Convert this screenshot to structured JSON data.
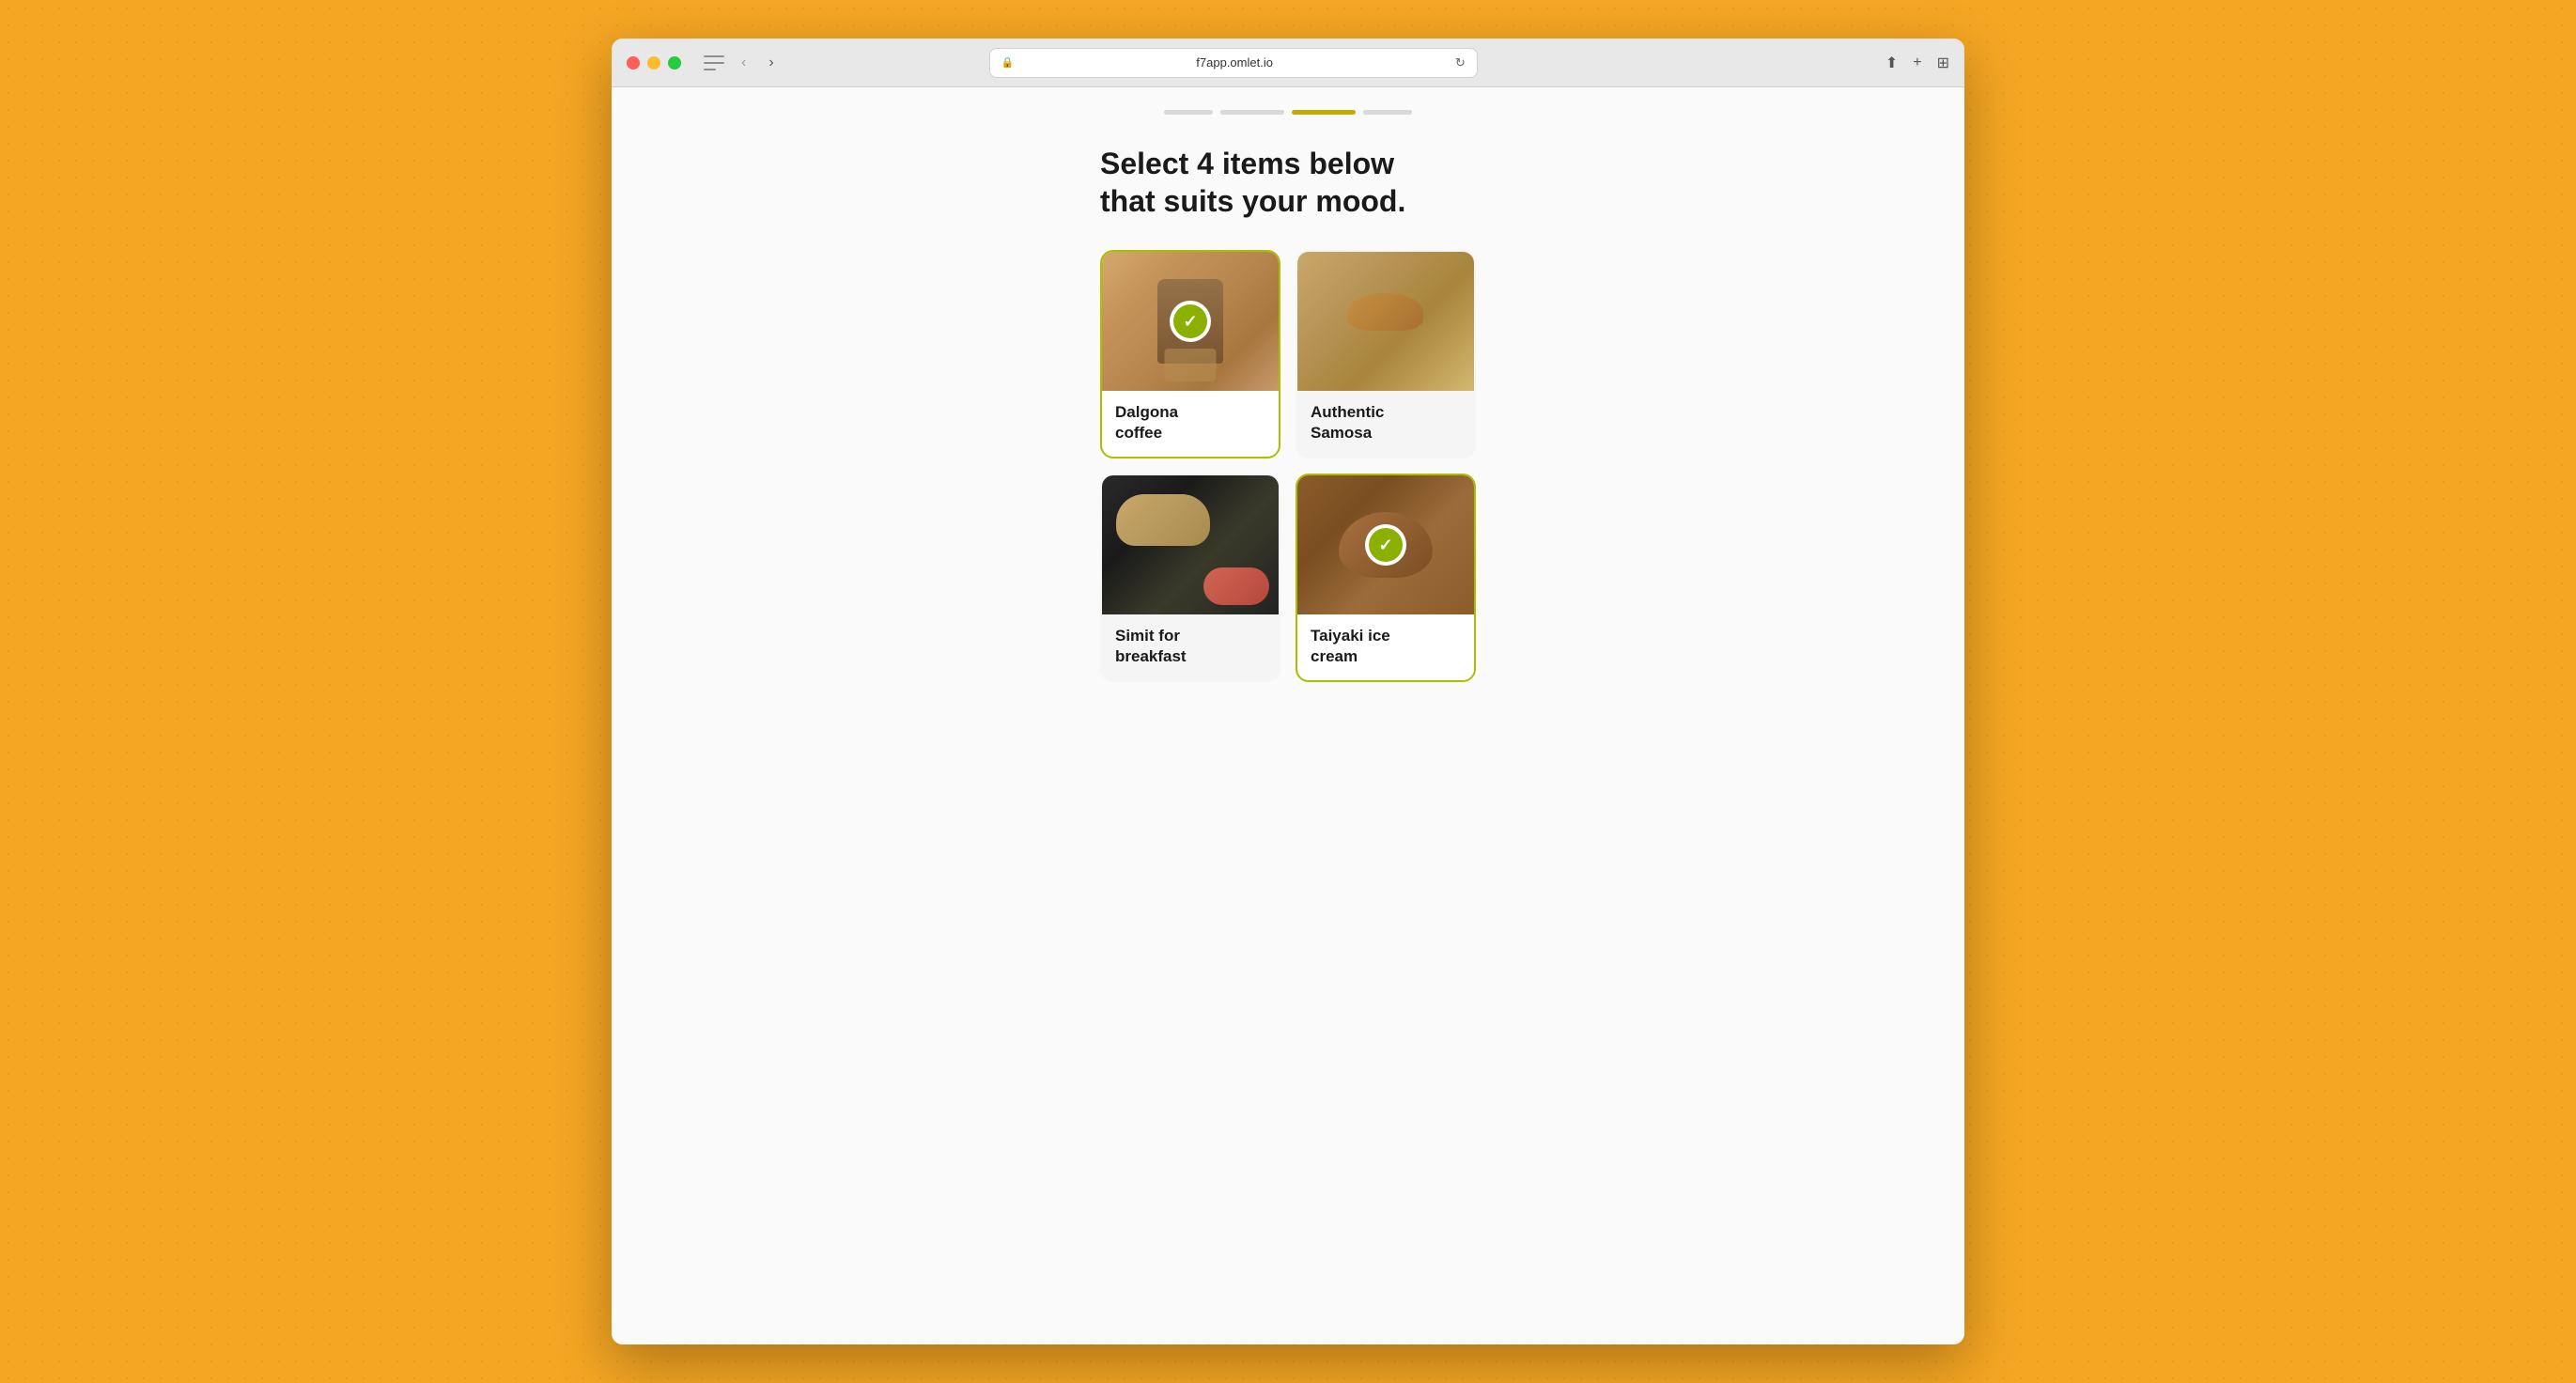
{
  "browser": {
    "url": "f7app.omlet.io",
    "back_label": "‹",
    "forward_label": "›",
    "refresh_label": "↻",
    "share_label": "⬆",
    "new_tab_label": "+",
    "tab_overview_label": "⊞"
  },
  "progress": {
    "dots": [
      {
        "active": false
      },
      {
        "active": false
      },
      {
        "active": true
      },
      {
        "active": false
      }
    ]
  },
  "page": {
    "heading_line1": "Select 4 items below",
    "heading_line2": "that suits your mood."
  },
  "food_items": [
    {
      "id": "dalgona-coffee",
      "label": "Dalgona\ncoffee",
      "label_line1": "Dalgona",
      "label_line2": "coffee",
      "selected": true,
      "image_type": "dalgona"
    },
    {
      "id": "authentic-samosa",
      "label": "Authentic\nSamosa",
      "label_line1": "Authentic",
      "label_line2": "Samosa",
      "selected": false,
      "image_type": "samosa"
    },
    {
      "id": "simit-breakfast",
      "label": "Simit for\nbreakfast",
      "label_line1": "Simit for",
      "label_line2": "breakfast",
      "selected": false,
      "image_type": "simit"
    },
    {
      "id": "taiyaki-ice-cream",
      "label": "Taiyaki ice\ncream",
      "label_line1": "Taiyaki ice",
      "label_line2": "cream",
      "selected": true,
      "image_type": "taiyaki"
    }
  ]
}
